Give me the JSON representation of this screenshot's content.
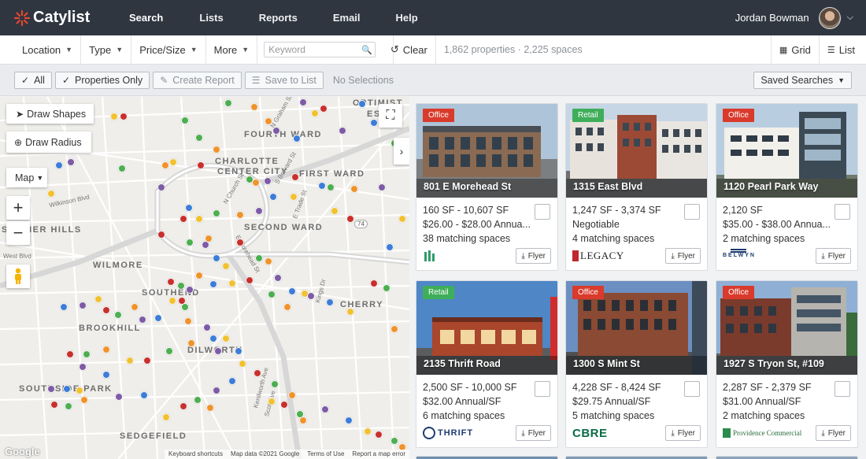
{
  "nav": {
    "brand": "Catylist",
    "items": [
      {
        "label": "Search",
        "active": true
      },
      {
        "label": "Lists"
      },
      {
        "label": "Reports"
      },
      {
        "label": "Email"
      },
      {
        "label": "Help"
      }
    ],
    "user_name": "Jordan Bowman"
  },
  "filters": {
    "location": "Location",
    "type": "Type",
    "price_size": "Price/Size",
    "more": "More",
    "keyword_placeholder": "Keyword",
    "clear": "Clear",
    "counts": "1,862 properties · 2,225 spaces",
    "grid": "Grid",
    "list": "List"
  },
  "actions": {
    "all": "All",
    "properties_only": "Properties Only",
    "create_report": "Create Report",
    "save_to_list": "Save to List",
    "no_selections": "No Selections",
    "saved_searches": "Saved Searches"
  },
  "map": {
    "draw_shapes": "Draw Shapes",
    "draw_radius": "Draw Radius",
    "map_type": "Map",
    "zoom_in": "+",
    "zoom_out": "−",
    "labels": {
      "fourth_ward": "FOURTH WARD",
      "charlotte": "CHARLOTTE",
      "center_city": "CENTER CITY",
      "first_ward": "FIRST WARD",
      "second_ward": "SECOND WARD",
      "wilmore": "WILMORE",
      "southend": "SOUTHEND",
      "brookhill": "BROOKHILL",
      "dilworth": "DILWORTH",
      "cherry": "CHERRY",
      "south_park": "SOUTHSIDE PARK",
      "sedgefield": "SEDGEFIELD",
      "esley": "ESLEY",
      "optimist": "OPTIMIST",
      "summer_hills": "SUMMER HILLS"
    },
    "streets": {
      "wilkinson": "Wilkinson Blvd",
      "west": "West Blvd",
      "church": "N Church St",
      "tryon": "E Trade St",
      "morehead": "E Morehead St",
      "kings": "Kings Dr",
      "kenilworth": "Kenilworth Ave",
      "scott": "Scott Ave",
      "graham": "N Graham St",
      "brevard": "S Brevard St",
      "s74": "74"
    },
    "footer": {
      "shortcuts": "Keyboard shortcuts",
      "mapdata": "Map data ©2021 Google",
      "terms": "Terms of Use",
      "report": "Report a map error"
    },
    "google": "Google"
  },
  "listings": [
    {
      "type": "Office",
      "badge_color": "#d93a2b",
      "title": "801 E Morehead St",
      "size": "160 SF - 10,607 SF",
      "price": "$26.00 - $28.00 Annua...",
      "matching": "38 matching spaces",
      "brand": "medical-building-logo",
      "flyer": "Flyer"
    },
    {
      "type": "Retail",
      "badge_color": "#3fae5a",
      "title": "1315 East Blvd",
      "size": "1,247 SF - 3,374 SF",
      "price": "Negotiable",
      "matching": "4 matching spaces",
      "brand": "LEGACY",
      "flyer": "Flyer"
    },
    {
      "type": "Office",
      "badge_color": "#d93a2b",
      "title": "1120 Pearl Park Way",
      "size": "2,120 SF",
      "price": "$35.00 - $38.00 Annua...",
      "matching": "2 matching spaces",
      "brand": "BELWYN",
      "flyer": "Flyer"
    },
    {
      "type": "Retail",
      "badge_color": "#3fae5a",
      "title": "2135 Thrift Road",
      "size": "2,500 SF - 10,000 SF",
      "price": "$32.00 Annual/SF",
      "matching": "6 matching spaces",
      "brand": "THRIFT",
      "flyer": "Flyer"
    },
    {
      "type": "Office",
      "badge_color": "#d93a2b",
      "title": "1300 S Mint St",
      "size": "4,228 SF - 8,424 SF",
      "price": "$29.75 Annual/SF",
      "matching": "5 matching spaces",
      "brand": "CBRE",
      "flyer": "Flyer"
    },
    {
      "type": "Office",
      "badge_color": "#d93a2b",
      "title": "1927 S Tryon St, #109",
      "size": "2,287 SF - 2,379 SF",
      "price": "$31.00 Annual/SF",
      "matching": "2 matching spaces",
      "brand": "Providence Commercial",
      "flyer": "Flyer"
    }
  ],
  "colors": {
    "nav_bg": "#2f3640",
    "office": "#d93a2b",
    "retail": "#3fae5a",
    "pin_green": "#4caf50",
    "pin_red": "#c9302c",
    "pin_orange": "#f0932b",
    "pin_blue": "#3c7dd9",
    "pin_purple": "#7d5ba6",
    "pin_yellow": "#f2c12e"
  }
}
